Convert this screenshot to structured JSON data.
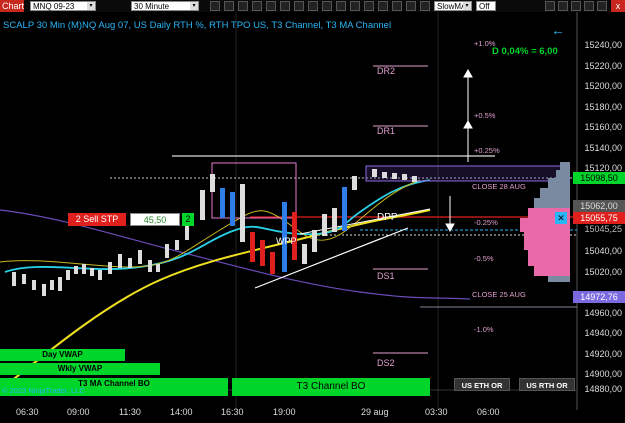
{
  "toolbar": {
    "chart_tab": "Chart",
    "instrument": "MNQ 09-23",
    "interval": "30 Minute",
    "indicator_select": "SlowMA",
    "toggle": "Off",
    "close_label": "x"
  },
  "chart": {
    "title": "SCALP 30 Min (M)NQ Aug 07, US Daily RTH %, RTH TPO US, T3 Channel, T3 MA Channel",
    "back_arrow": "←",
    "change_readout": "D 0,04% = 6,00",
    "price_axis": [
      "15240,00",
      "15220,00",
      "15200,00",
      "15180,00",
      "15160,00",
      "15140,00",
      "15120,00",
      "15098,50",
      "15055,75",
      "15040,00",
      "15020,00",
      "15000,00",
      "14972,76",
      "14960,00",
      "14940,00",
      "14920,00",
      "14900,00",
      "14880,00"
    ],
    "time_axis": [
      "06:30",
      "09:00",
      "11:30",
      "14:00",
      "16:30",
      "19:00",
      "29 aug",
      "03:30",
      "06:00"
    ],
    "levels": {
      "dr2": "DR2",
      "dr1": "DR1",
      "dpp": "DPP",
      "ds1": "DS1",
      "ds2": "DS2",
      "wpp": "WPP"
    },
    "pct_levels": [
      "+1.0%",
      "+0.5%",
      "+0.25%",
      "-0.25%",
      "-0.5%",
      "-1.0%"
    ],
    "closes": [
      "CLOSE 28 AUG",
      "CLOSE 25 AUG"
    ],
    "order": {
      "sell_label": "2  Sell STP",
      "price": "45,50",
      "qty": "2"
    },
    "price_tags": {
      "last": "15098,50",
      "stop": "15055,75",
      "stop_sub": "15045,25",
      "low": "14972,76",
      "mid": "15062,00"
    },
    "vwap_buttons": [
      "Day VWAP",
      "Wkly VWAP",
      "T3 MA Channel BO"
    ],
    "channel_button": "T3 Channel BO",
    "session_buttons": [
      "US ETH OR",
      "US RTH OR"
    ],
    "copyright": "© 2023 NinjaTrader, LLC"
  },
  "colors": {
    "accent_blue": "#29b6f6",
    "up_green": "#00d62a",
    "stop_red": "#e0201c",
    "level_pink": "#e29fcf",
    "ma_yellow": "#f0e020"
  }
}
